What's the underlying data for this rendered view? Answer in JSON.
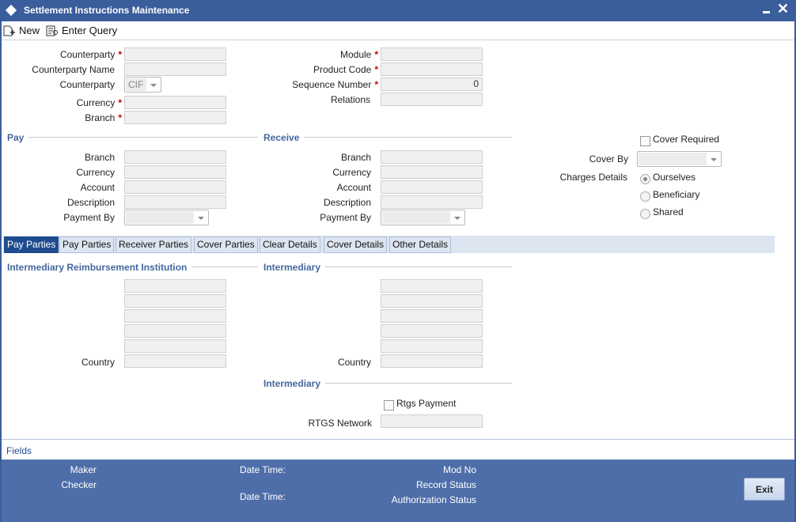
{
  "window": {
    "title": "Settlement Instructions Maintenance"
  },
  "toolbar": {
    "new_label": "New",
    "enter_query_label": "Enter Query"
  },
  "header": {
    "counterparty_label": "Counterparty",
    "counterparty_name_label": "Counterparty Name",
    "counterparty_type_label": "Counterparty",
    "counterparty_type_value": "CIF",
    "currency_label": "Currency",
    "branch_label": "Branch",
    "module_label": "Module",
    "product_code_label": "Product Code",
    "sequence_number_label": "Sequence Number",
    "sequence_number_value": "0",
    "relations_label": "Relations",
    "required_mark": "*"
  },
  "pay": {
    "section_title": "Pay",
    "branch_label": "Branch",
    "currency_label": "Currency",
    "account_label": "Account",
    "description_label": "Description",
    "payment_by_label": "Payment By"
  },
  "receive": {
    "section_title": "Receive",
    "branch_label": "Branch",
    "currency_label": "Currency",
    "account_label": "Account",
    "description_label": "Description",
    "payment_by_label": "Payment By"
  },
  "cover": {
    "cover_required_label": "Cover Required",
    "cover_by_label": "Cover By",
    "charges_details_label": "Charges Details",
    "charges_options": [
      "Ourselves",
      "Beneficiary",
      "Shared"
    ],
    "charges_selected": "Ourselves"
  },
  "tabs": [
    "Pay Parties",
    "Pay Parties",
    "Receiver Parties",
    "Cover Parties",
    "Clear Details",
    "Cover Details",
    "Other Details"
  ],
  "pay_parties": {
    "left_section": "Intermediary Reimbursement Institution",
    "right_section": "Intermediary",
    "country_label": "Country",
    "lower_section": "Intermediary",
    "rtgs_payment_label": "Rtgs Payment",
    "rtgs_network_label": "RTGS Network"
  },
  "fields_link": "Fields",
  "footer": {
    "maker_label": "Maker",
    "checker_label": "Checker",
    "date_time_label": "Date Time:",
    "mod_no_label": "Mod No",
    "record_status_label": "Record Status",
    "authorization_status_label": "Authorization Status",
    "exit_label": "Exit"
  },
  "colors": {
    "title_bar": "#3a5d9c",
    "section_title": "#44679e",
    "active_tab": "#1f4c8f",
    "footer": "#4e6ea9",
    "required": "#cc0000"
  }
}
